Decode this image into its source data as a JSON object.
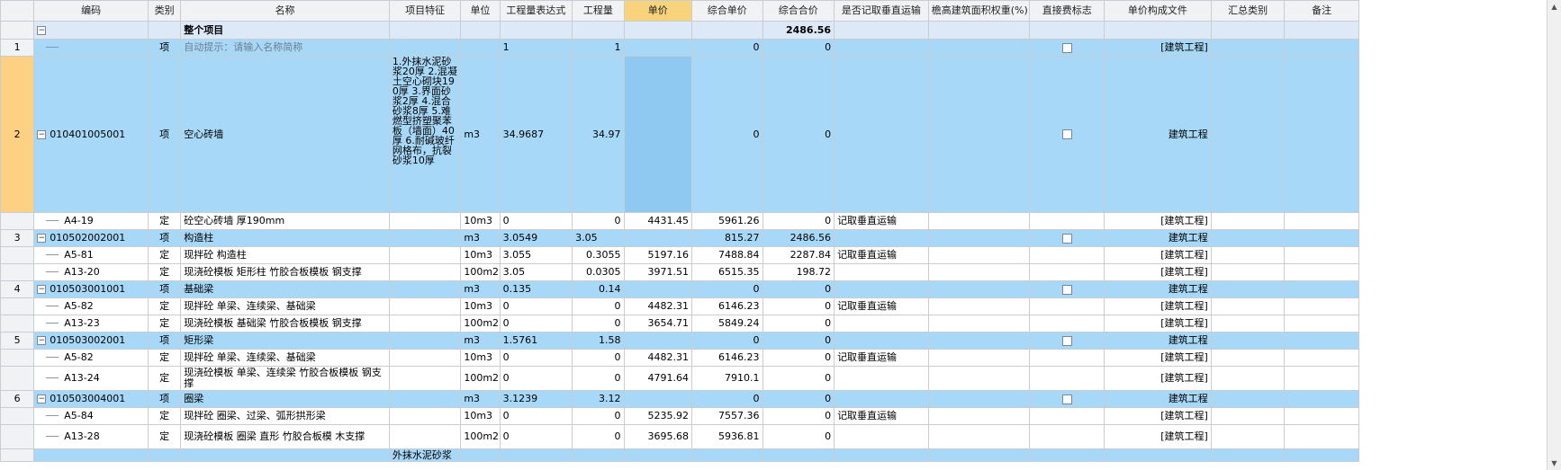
{
  "headers": {
    "code": "编码",
    "type": "类别",
    "name": "名称",
    "feature": "项目特征",
    "unit": "单位",
    "expr": "工程量表达式",
    "qty": "工程量",
    "price": "单价",
    "comp_price": "综合单价",
    "comp_total": "综合合价",
    "vertical": "是否记取垂直运输",
    "eaves": "檐高建筑面积权重(%)",
    "direct": "直接费标志",
    "price_file": "单价构成文件",
    "summary": "汇总类别",
    "remark": "备注"
  },
  "project_row": {
    "name": "整个项目",
    "comp_total": "2486.56",
    "toggle": "−"
  },
  "row1": {
    "num": "1",
    "type": "项",
    "name": "自动提示：请输入名称简称",
    "expr": "1",
    "qty": "1",
    "comp_price": "0",
    "comp_total": "0",
    "price_file": "[建筑工程]"
  },
  "row2": {
    "num": "2",
    "code": "010401005001",
    "type": "项",
    "name": "空心砖墙",
    "feature": "1.外抹水泥砂浆20厚 2.混凝土空心砌块190厚 3.界面砂浆2厚 4.混合砂浆8厚 5.难燃型挤塑聚苯板（墙面）40厚 6.耐碱玻纤网格布，抗裂砂浆10厚",
    "unit": "m3",
    "expr": "34.9687",
    "qty": "34.97",
    "comp_price": "0",
    "comp_total": "0",
    "price_file": "建筑工程"
  },
  "row2a": {
    "code": "A4-19",
    "type": "定",
    "name": "砼空心砖墙 厚190mm",
    "unit": "10m3",
    "expr": "0",
    "qty": "0",
    "price": "4431.45",
    "comp_price": "5961.26",
    "comp_total": "0",
    "vertical": "记取垂直运输",
    "price_file": "[建筑工程]"
  },
  "row3": {
    "num": "3",
    "code": "010502002001",
    "type": "项",
    "name": "构造柱",
    "unit": "m3",
    "expr": "3.0549",
    "qty": "3.05",
    "comp_price": "815.27",
    "comp_total": "2486.56",
    "price_file": "建筑工程"
  },
  "row3a": {
    "code": "A5-81",
    "type": "定",
    "name": "现拌砼 构造柱",
    "unit": "10m3",
    "expr": "3.055",
    "qty": "0.3055",
    "price": "5197.16",
    "comp_price": "7488.84",
    "comp_total": "2287.84",
    "vertical": "记取垂直运输",
    "price_file": "[建筑工程]"
  },
  "row3b": {
    "code": "A13-20",
    "type": "定",
    "name": "现浇砼模板 矩形柱 竹胶合板模板 钢支撑",
    "unit": "100m2",
    "expr": "3.05",
    "qty": "0.0305",
    "price": "3971.51",
    "comp_price": "6515.35",
    "comp_total": "198.72",
    "price_file": "[建筑工程]"
  },
  "row4": {
    "num": "4",
    "code": "010503001001",
    "type": "项",
    "name": "基础梁",
    "unit": "m3",
    "expr": "0.135",
    "qty": "0.14",
    "comp_price": "0",
    "comp_total": "0",
    "price_file": "建筑工程"
  },
  "row4a": {
    "code": "A5-82",
    "type": "定",
    "name": "现拌砼 单梁、连续梁、基础梁",
    "unit": "10m3",
    "expr": "0",
    "qty": "0",
    "price": "4482.31",
    "comp_price": "6146.23",
    "comp_total": "0",
    "vertical": "记取垂直运输",
    "price_file": "[建筑工程]"
  },
  "row4b": {
    "code": "A13-23",
    "type": "定",
    "name": "现浇砼模板 基础梁 竹胶合板模板 钢支撑",
    "unit": "100m2",
    "expr": "0",
    "qty": "0",
    "price": "3654.71",
    "comp_price": "5849.24",
    "comp_total": "0",
    "price_file": "[建筑工程]"
  },
  "row5": {
    "num": "5",
    "code": "010503002001",
    "type": "项",
    "name": "矩形梁",
    "unit": "m3",
    "expr": "1.5761",
    "qty": "1.58",
    "comp_price": "0",
    "comp_total": "0",
    "price_file": "建筑工程"
  },
  "row5a": {
    "code": "A5-82",
    "type": "定",
    "name": "现拌砼 单梁、连续梁、基础梁",
    "unit": "10m3",
    "expr": "0",
    "qty": "0",
    "price": "4482.31",
    "comp_price": "6146.23",
    "comp_total": "0",
    "vertical": "记取垂直运输",
    "price_file": "[建筑工程]"
  },
  "row5b": {
    "code": "A13-24",
    "type": "定",
    "name": "现浇砼模板 单梁、连续梁 竹胶合板模板 钢支撑",
    "unit": "100m2",
    "expr": "0",
    "qty": "0",
    "price": "4791.64",
    "comp_price": "7910.1",
    "comp_total": "0",
    "price_file": "[建筑工程]"
  },
  "row6": {
    "num": "6",
    "code": "010503004001",
    "type": "项",
    "name": "圈梁",
    "unit": "m3",
    "expr": "3.1239",
    "qty": "3.12",
    "comp_price": "0",
    "comp_total": "0",
    "price_file": "建筑工程"
  },
  "row6a": {
    "code": "A5-84",
    "type": "定",
    "name": "现拌砼 圈梁、过梁、弧形拱形梁",
    "unit": "10m3",
    "expr": "0",
    "qty": "0",
    "price": "5235.92",
    "comp_price": "7557.36",
    "comp_total": "0",
    "vertical": "记取垂直运输",
    "price_file": "[建筑工程]"
  },
  "row6b": {
    "code": "A13-28",
    "type": "定",
    "name": "现浇砼模板 圈梁 直形 竹胶合板模 木支撑",
    "unit": "100m2",
    "expr": "0",
    "qty": "0",
    "price": "3695.68",
    "comp_price": "5936.81",
    "comp_total": "0",
    "price_file": "[建筑工程]"
  },
  "row7": {
    "feature": "外抹水泥砂浆"
  },
  "toggle": "−"
}
